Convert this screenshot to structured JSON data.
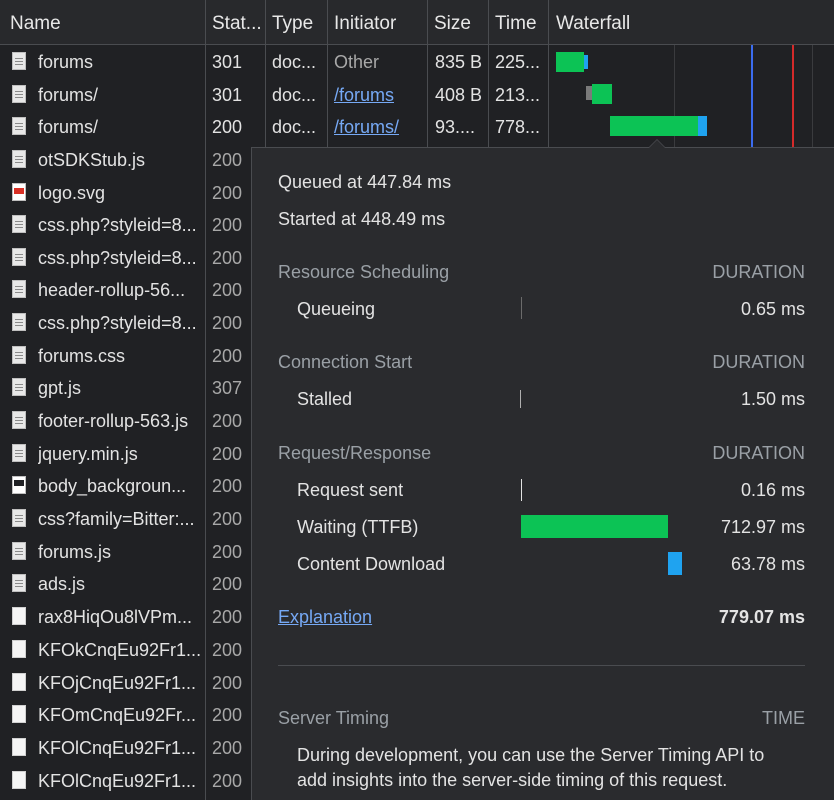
{
  "columns": {
    "name": "Name",
    "status": "Stat...",
    "type": "Type",
    "initiator": "Initiator",
    "size": "Size",
    "time": "Time",
    "waterfall": "Waterfall"
  },
  "rows": [
    {
      "name": "forums",
      "status": "301",
      "type": "doc...",
      "initiator": "Other",
      "size": "835 B",
      "time": "225...",
      "icon": "document-icon"
    },
    {
      "name": "forums/",
      "status": "301",
      "type": "doc...",
      "initiator": "/forums",
      "size": "408 B",
      "time": "213...",
      "icon": "document-icon"
    },
    {
      "name": "forums/",
      "status": "200",
      "type": "doc...",
      "initiator": "/forums/",
      "size": "93....",
      "time": "778...",
      "icon": "document-icon"
    },
    {
      "name": "otSDKStub.js",
      "status": "200",
      "icon": "document-icon"
    },
    {
      "name": "logo.svg",
      "status": "200",
      "icon": "svg-image-icon"
    },
    {
      "name": "css.php?styleid=8...",
      "status": "200",
      "icon": "document-icon"
    },
    {
      "name": "css.php?styleid=8...",
      "status": "200",
      "icon": "document-icon"
    },
    {
      "name": "header-rollup-56...",
      "status": "200",
      "icon": "document-icon"
    },
    {
      "name": "css.php?styleid=8...",
      "status": "200",
      "icon": "document-icon"
    },
    {
      "name": "forums.css",
      "status": "200",
      "icon": "document-icon"
    },
    {
      "name": "gpt.js",
      "status": "307",
      "icon": "document-icon"
    },
    {
      "name": "footer-rollup-563.js",
      "status": "200",
      "icon": "document-icon"
    },
    {
      "name": "jquery.min.js",
      "status": "200",
      "icon": "document-icon"
    },
    {
      "name": "body_backgroun...",
      "status": "200",
      "icon": "image-icon"
    },
    {
      "name": "css?family=Bitter:...",
      "status": "200",
      "icon": "document-icon"
    },
    {
      "name": "forums.js",
      "status": "200",
      "icon": "document-icon"
    },
    {
      "name": "ads.js",
      "status": "200",
      "icon": "document-icon"
    },
    {
      "name": "rax8HiqOu8lVPm...",
      "status": "200",
      "icon": "font-icon"
    },
    {
      "name": "KFOkCnqEu92Fr1...",
      "status": "200",
      "icon": "font-icon"
    },
    {
      "name": "KFOjCnqEu92Fr1...",
      "status": "200",
      "icon": "font-icon"
    },
    {
      "name": "KFOmCnqEu92Fr...",
      "status": "200",
      "icon": "font-icon"
    },
    {
      "name": "KFOlCnqEu92Fr1...",
      "status": "200",
      "icon": "font-icon"
    },
    {
      "name": "KFOlCnqEu92Fr1...",
      "status": "200",
      "icon": "font-icon"
    }
  ],
  "timing_popup": {
    "queued": "Queued at 447.84 ms",
    "started": "Started at 448.49 ms",
    "sections": [
      {
        "title": "Resource Scheduling",
        "duration_label": "DURATION",
        "phases": [
          {
            "label": "Queueing",
            "value": "0.65 ms"
          }
        ]
      },
      {
        "title": "Connection Start",
        "duration_label": "DURATION",
        "phases": [
          {
            "label": "Stalled",
            "value": "1.50 ms"
          }
        ]
      },
      {
        "title": "Request/Response",
        "duration_label": "DURATION",
        "phases": [
          {
            "label": "Request sent",
            "value": "0.16 ms"
          },
          {
            "label": "Waiting (TTFB)",
            "value": "712.97 ms"
          },
          {
            "label": "Content Download",
            "value": "63.78 ms"
          }
        ]
      }
    ],
    "explanation_link": "Explanation",
    "total": "779.07 ms",
    "server_timing": {
      "title": "Server Timing",
      "time_label": "TIME",
      "text_line1": "During development, you can use the Server Timing API to",
      "text_line2": "add insights into the server-side timing of this request."
    }
  },
  "colors": {
    "waiting_bar": "#0cc355",
    "download_bar": "#1fa3f0",
    "dom_content_line": "#3b6cf0",
    "load_line": "#d42a2a"
  }
}
